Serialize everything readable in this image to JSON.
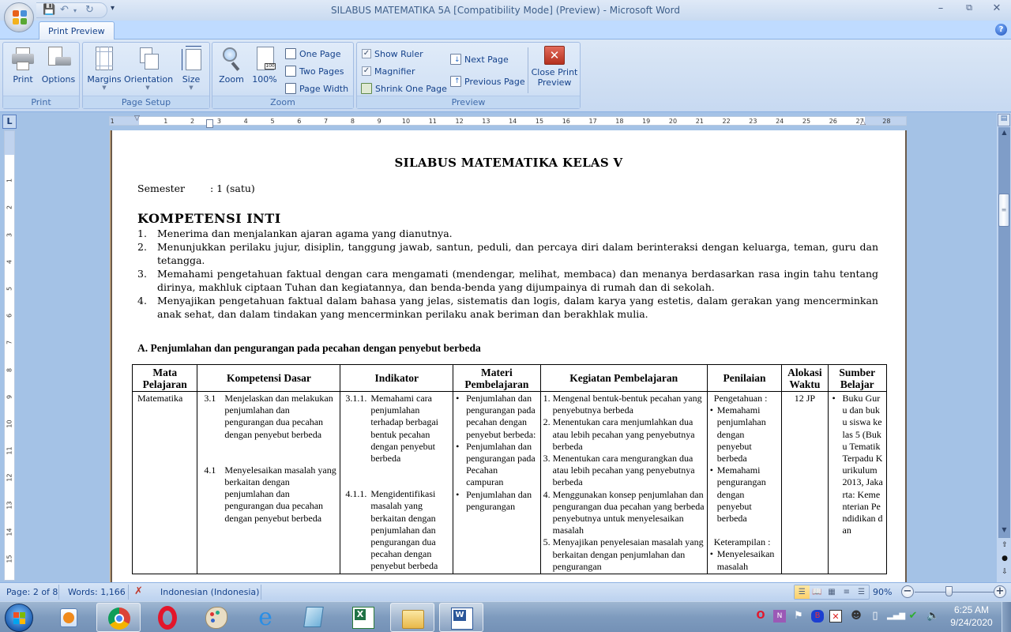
{
  "window": {
    "title": "SILABUS MATEMATIKA 5A [Compatibility Mode] (Preview) - Microsoft Word",
    "controls": [
      "minimize",
      "restore",
      "close"
    ]
  },
  "quick_access": {
    "save_icon": "save-icon",
    "undo_icon": "undo-icon",
    "redo_icon": "redo-icon"
  },
  "ribbon": {
    "active_tab": "Print Preview",
    "groups": {
      "print": {
        "label": "Print",
        "buttons": [
          "Print",
          "Options"
        ]
      },
      "page_setup": {
        "label": "Page Setup",
        "buttons": [
          "Margins",
          "Orientation",
          "Size"
        ]
      },
      "zoom": {
        "label": "Zoom",
        "buttons": [
          "Zoom",
          "100%"
        ],
        "small_buttons": [
          "One Page",
          "Two Pages",
          "Page Width"
        ]
      },
      "preview": {
        "label": "Preview",
        "show_ruler": {
          "label": "Show Ruler",
          "checked": true
        },
        "magnifier": {
          "label": "Magnifier",
          "checked": true
        },
        "shrink_one_page": "Shrink One Page",
        "next_page": "Next Page",
        "previous_page": "Previous Page",
        "close_print_preview": [
          "Close Print",
          "Preview"
        ]
      }
    }
  },
  "ruler": {
    "corner": "L",
    "h_ticks": [
      "1",
      "1",
      "2",
      "3",
      "4",
      "5",
      "6",
      "7",
      "8",
      "9",
      "10",
      "11",
      "12",
      "13",
      "14",
      "15",
      "16",
      "17",
      "18",
      "19",
      "20",
      "21",
      "22",
      "23",
      "24",
      "25",
      "26",
      "27",
      "28"
    ],
    "v_ticks": [
      "1",
      "2",
      "3",
      "4",
      "5",
      "6",
      "7",
      "8",
      "9",
      "10",
      "11",
      "12",
      "13",
      "14",
      "15"
    ]
  },
  "document": {
    "title": "SILABUS MATEMATIKA KELAS V",
    "semester_label": "Semester",
    "semester_value": ": 1 (satu)",
    "ki_heading": "KOMPETENSI INTI",
    "ki_items": [
      {
        "num": "1.",
        "text": "Menerima dan menjalankan ajaran agama yang dianutnya."
      },
      {
        "num": "2.",
        "text": "Menunjukkan perilaku jujur, disiplin, tanggung jawab, santun, peduli, dan percaya diri dalam berinteraksi dengan keluarga, teman, guru dan tetangga."
      },
      {
        "num": "3.",
        "text": "Memahami pengetahuan faktual dengan cara mengamati (mendengar, melihat, membaca) dan menanya berdasarkan rasa ingin tahu tentang dirinya, makhluk ciptaan Tuhan dan kegiatannya, dan benda-benda yang dijumpainya di rumah dan di sekolah."
      },
      {
        "num": "4.",
        "text": "Menyajikan pengetahuan faktual dalam bahasa yang jelas, sistematis dan logis, dalam karya yang estetis, dalam gerakan yang mencerminkan anak sehat, dan dalam tindakan yang mencerminkan  perilaku anak beriman dan berakhlak mulia."
      }
    ],
    "section_a": "A.  Penjumlahan dan pengurangan pada pecahan dengan penyebut berbeda",
    "table": {
      "headers": [
        "Mata Pelajaran",
        "Kompetensi Dasar",
        "Indikator",
        "Materi Pembelajaran",
        "Kegiatan Pembelajaran",
        "Penilaian",
        "Alokasi Waktu",
        "Sumber Belajar"
      ],
      "row": {
        "mata_pelajaran": "Matematika",
        "kompetensi_dasar": [
          {
            "num": "3.1",
            "text": "Menjelaskan dan melakukan penjumlahan dan pengurangan dua pecahan dengan penyebut berbeda"
          },
          {
            "num": "4.1",
            "text": "Menyelesaikan masalah yang berkaitan dengan penjumlahan dan pengurangan dua pecahan dengan penyebut berbeda"
          }
        ],
        "indikator": [
          {
            "num": "3.1.1.",
            "text": "Memahami cara penjumlahan terhadap berbagai bentuk pecahan dengan penyebut berbeda"
          },
          {
            "num": "4.1.1.",
            "text": "Mengidentifikasi masalah yang berkaitan dengan penjumlahan dan pengurangan dua pecahan dengan penyebut berbeda"
          }
        ],
        "materi": [
          "Penjumlahan dan pengurangan pada pecahan dengan penyebut berbeda:",
          "Penjumlahan dan pengurangan pada Pecahan campuran",
          "Penjumlahan dan pengurangan"
        ],
        "kegiatan": [
          {
            "num": "1.",
            "text": "Mengenal bentuk-bentuk pecahan yang penyebutnya berbeda"
          },
          {
            "num": "2.",
            "text": "Menentukan cara menjumlahkan dua atau lebih pecahan yang penyebutnya berbeda"
          },
          {
            "num": "3.",
            "text": "Menentukan cara mengurangkan dua atau lebih pecahan yang penyebutnya berbeda"
          },
          {
            "num": "4.",
            "text": "Menggunakan konsep penjumlahan dan pengurangan dua pecahan yang berbeda penyebutnya untuk menyelesaikan masalah"
          },
          {
            "num": "5.",
            "text": "Menyajikan penyelesaian masalah yang berkaitan dengan penjumlahan dan pengurangan"
          }
        ],
        "penilaian": {
          "pengetahuan_label": "Pengetahuan :",
          "pengetahuan_items": [
            "Memahami penjumlahan dengan penyebut berbeda",
            "Memahami pengurangan dengan penyebut berbeda"
          ],
          "keterampilan_label": "Keterampilan :",
          "keterampilan_items": [
            "Menyelesaikan masalah"
          ]
        },
        "alokasi_waktu": "12 JP",
        "sumber_belajar": [
          "Buku Guru dan buku siswa kelas 5 (Buku Tematik Terpadu Kurikulum 2013, Jakarta: Kementerian Pendidikan dan"
        ]
      }
    }
  },
  "statusbar": {
    "page": "Page: 2 of 8",
    "words": "Words: 1,166",
    "language": "Indonesian (Indonesia)",
    "zoom_level": "90%",
    "zoom_percent": 90
  },
  "taskbar": {
    "apps": [
      "Windows Media Player",
      "Google Chrome",
      "Opera",
      "Paint",
      "Internet Explorer",
      "Notepad",
      "Microsoft Excel",
      "Windows Explorer",
      "Microsoft Word"
    ],
    "tray_icons": [
      "opera-icon",
      "onenote-icon",
      "action-center-flag-icon",
      "bluetooth-icon",
      "network-error-icon",
      "user-accounts-icon",
      "battery-icon",
      "signal-icon",
      "power-plug-icon",
      "volume-icon"
    ],
    "time": "6:25 AM",
    "date": "9/24/2020"
  }
}
